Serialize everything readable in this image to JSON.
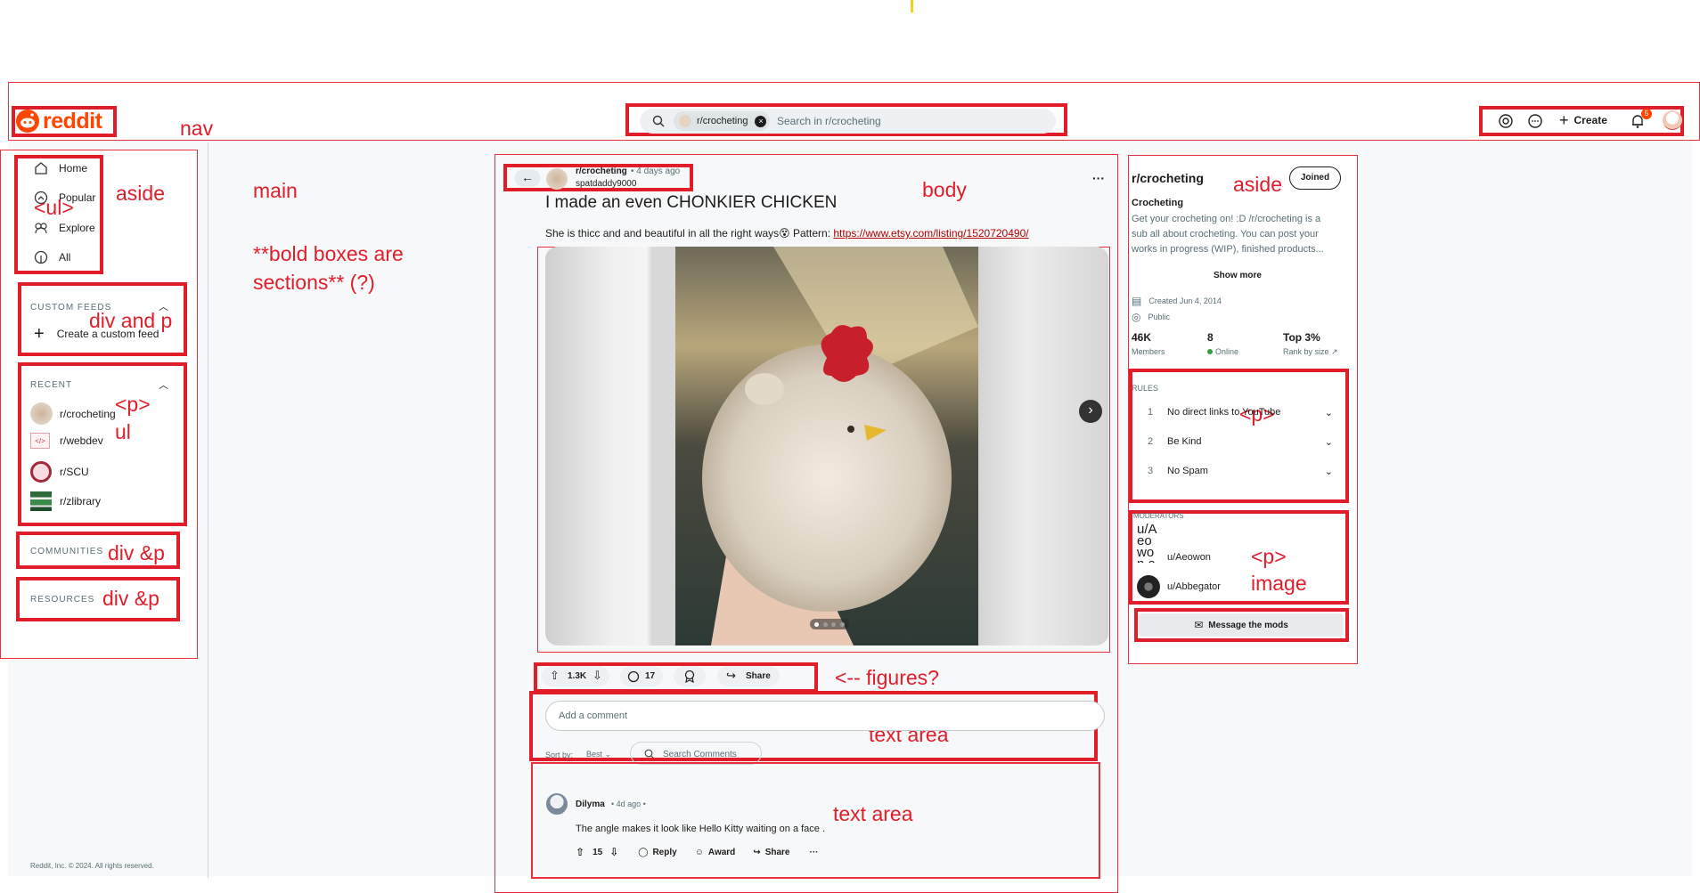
{
  "nav": {
    "logo_text": "reddit",
    "search_chip": "r/crocheting",
    "search_placeholder": "Search in r/crocheting",
    "create_label": "Create",
    "notification_count": "5"
  },
  "left": {
    "nav_items": [
      "Home",
      "Popular",
      "Explore",
      "All"
    ],
    "custom_feeds_heading": "CUSTOM FEEDS",
    "create_feed_label": "Create a custom feed",
    "recent_heading": "RECENT",
    "recent": [
      "r/crocheting",
      "r/webdev",
      "r/SCU",
      "r/zlibrary"
    ],
    "communities_heading": "COMMUNITIES",
    "resources_heading": "RESOURCES",
    "footer": "Reddit, Inc. © 2024. All rights reserved."
  },
  "post": {
    "subreddit": "r/crocheting",
    "time": "• 4 days ago",
    "author": "spatdaddy9000",
    "title": "I made an even CHONKIER CHICKEN",
    "body_text": "She is thicc and and beautiful in all the right ways😵 Pattern: ",
    "body_link": "https://www.etsy.com/listing/1520720490/",
    "more": "···",
    "votes": "1.3K",
    "comments": "17",
    "share": "Share",
    "comment_placeholder": "Add a comment",
    "sort_label": "Sort by:",
    "sort_value": "Best",
    "search_comments": "Search Comments",
    "image_count": 4
  },
  "comment": {
    "author": "Dilyma",
    "time": "• 4d ago •",
    "text": "The angle makes it look like Hello Kitty waiting on a face .",
    "votes": "15",
    "reply": "Reply",
    "award": "Award",
    "share": "Share",
    "more": "···"
  },
  "sidebar": {
    "name": "r/crocheting",
    "joined_label": "Joined",
    "title": "Crocheting",
    "description": "Get your crocheting on! :D /r/crocheting is a sub all about crocheting. You can post your works in progress (WIP), finished products...",
    "show_more": "Show more",
    "created": "Created Jun 4, 2014",
    "visibility": "Public",
    "stats": [
      {
        "value": "46K",
        "label": "Members"
      },
      {
        "value": "8",
        "label": "Online"
      },
      {
        "value": "Top 3%",
        "label": "Rank by size"
      }
    ],
    "rules_heading": "RULES",
    "rules": [
      {
        "num": "1",
        "text": "No direct links to YouTube"
      },
      {
        "num": "2",
        "text": "Be Kind"
      },
      {
        "num": "3",
        "text": "No Spam"
      }
    ],
    "moderators_heading": "MODERATORS",
    "moderators": [
      "u/Aeowon",
      "u/Abbegator"
    ],
    "broken_img_alt": "u/Aeowon ava",
    "message_mods": "Message the mods"
  },
  "annotations": {
    "nav": "nav",
    "aside_left": "aside",
    "ul": "<ul>",
    "div_p_1": "div and p",
    "p_recent": "<p>",
    "ul_recent": "ul",
    "div_p_2": "div &p",
    "div_p_3": "div &p",
    "main": "main",
    "bold_note_1": "**bold boxes are",
    "bold_note_2": "sections** (?)",
    "body": "body",
    "image": "image",
    "figures": "<-- figures?",
    "text_area_1": "text area",
    "text_area_2": "text area",
    "aside_right": "aside",
    "p_rules": "<p>",
    "p_mods": "<p>",
    "image_mods": "image"
  },
  "colors": {
    "reddit_orange": "#ff4500",
    "annotation_red": "#e11d2a",
    "online_green": "#2e9e3e"
  }
}
